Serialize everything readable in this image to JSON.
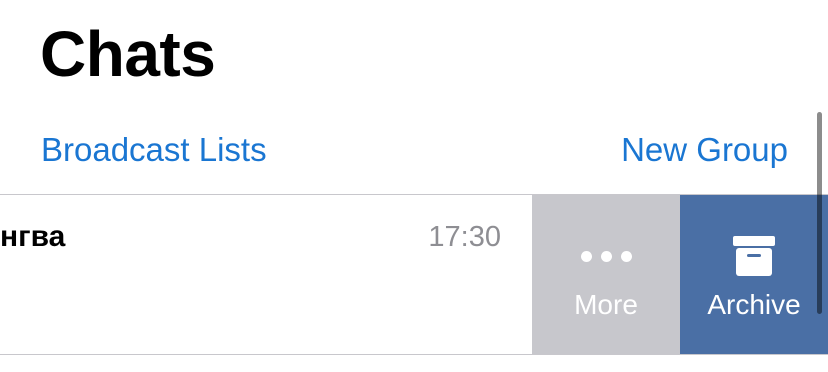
{
  "header": {
    "title": "Chats",
    "broadcast_label": "Broadcast Lists",
    "new_group_label": "New Group"
  },
  "chat": {
    "name": "нгва",
    "time": "17:30"
  },
  "swipe_actions": {
    "more_label": "More",
    "more_icon": "more-dots-icon",
    "archive_label": "Archive",
    "archive_icon": "archive-box-icon"
  },
  "colors": {
    "accent": "#1a76d2",
    "more_bg": "#c7c7cc",
    "archive_bg": "#4a6fa5",
    "time_text": "#8e8e93"
  }
}
